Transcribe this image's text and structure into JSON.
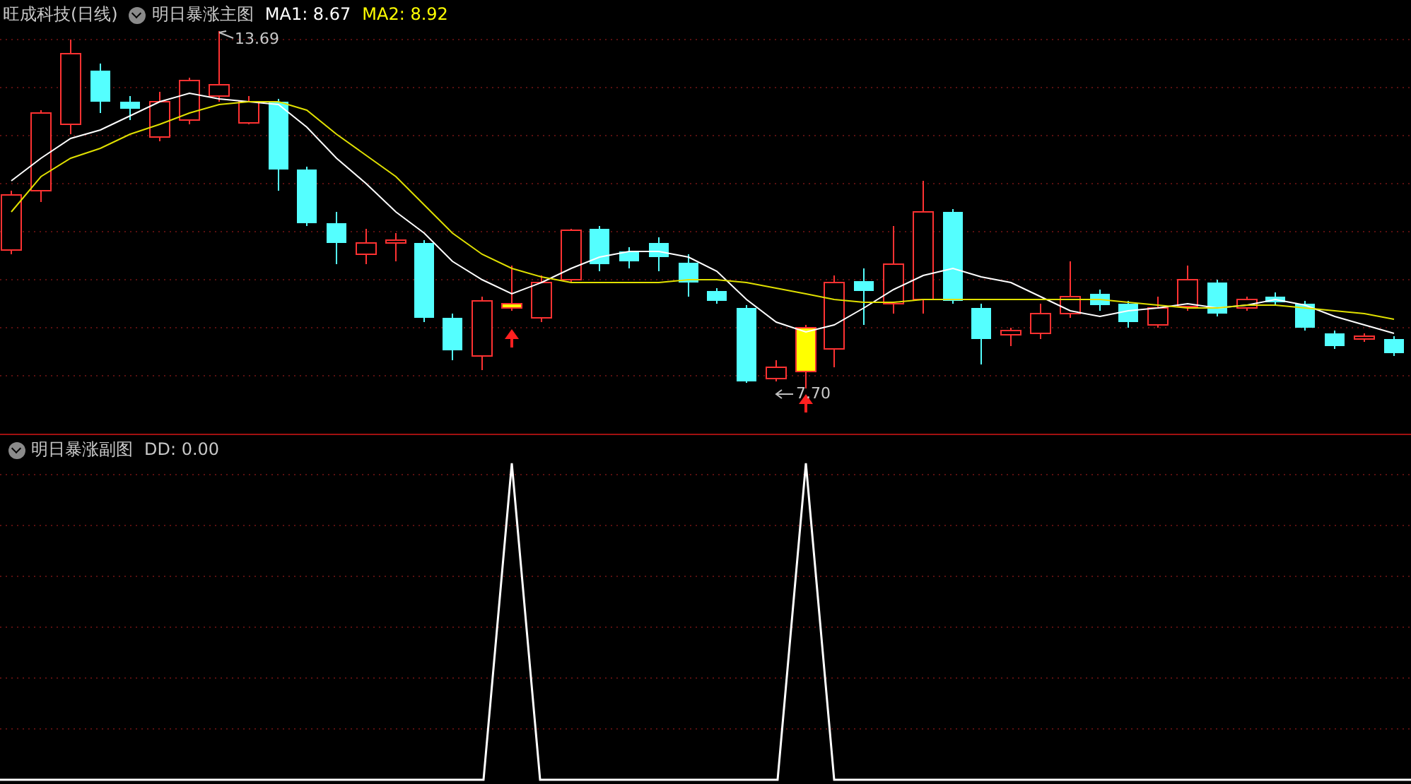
{
  "main_panel": {
    "stock_title": "旺成科技(日线)",
    "indicator": "明日暴涨主图",
    "ma_readings": [
      {
        "label": "MA1: 8.67",
        "color": "#ffffff"
      },
      {
        "label": "MA2: 8.92",
        "color": "#ffff00"
      }
    ],
    "price_labels": [
      {
        "text": "13.69",
        "kind": "high"
      },
      {
        "text": "7.70",
        "kind": "low"
      }
    ]
  },
  "sub_panel": {
    "indicator": "明日暴涨副图",
    "reading": "DD: 0.00"
  }
}
